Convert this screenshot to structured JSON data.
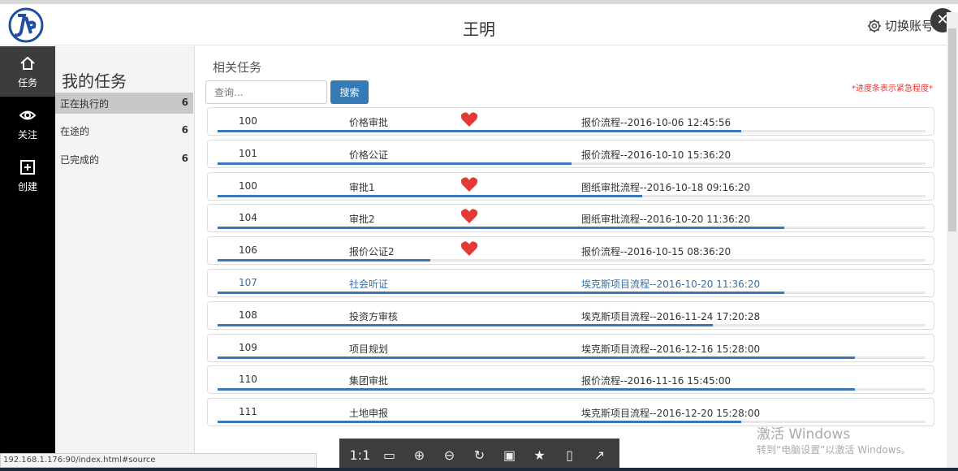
{
  "header": {
    "user_name": "王明",
    "switch_account": "切换账号",
    "close": "✕"
  },
  "leftnav": [
    {
      "label": "任务",
      "icon": "home-icon",
      "active": true
    },
    {
      "label": "关注",
      "icon": "eye-icon",
      "active": false
    },
    {
      "label": "创建",
      "icon": "plus-square-icon",
      "active": false
    }
  ],
  "secondary": {
    "title": "我的任务",
    "items": [
      {
        "label": "正在执行的",
        "count": "6"
      },
      {
        "label": "在途的",
        "count": "6"
      },
      {
        "label": "已完成的",
        "count": "6"
      }
    ]
  },
  "main": {
    "title": "相关任务",
    "search_placeholder": "查询...",
    "search_button": "搜索",
    "note": "*进度条表示紧急程度*"
  },
  "tasks": [
    {
      "id": "100",
      "name": "价格审批",
      "flow": "报价流程--2016-10-06 12:45:56",
      "urgent": true,
      "progress": 0.74
    },
    {
      "id": "101",
      "name": "价格公证",
      "flow": "报价流程--2016-10-10 15:36:20",
      "urgent": false,
      "progress": 0.5
    },
    {
      "id": "100",
      "name": "审批1",
      "flow": "图纸审批流程--2016-10-18 09:16:20",
      "urgent": true,
      "progress": 0.6
    },
    {
      "id": "104",
      "name": "审批2",
      "flow": "图纸审批流程--2016-10-20 11:36:20",
      "urgent": true,
      "progress": 0.8
    },
    {
      "id": "106",
      "name": "报价公证2",
      "flow": "报价流程--2016-10-15 08:36:20",
      "urgent": true,
      "progress": 0.3
    },
    {
      "id": "107",
      "name": "社会听证",
      "flow": "埃克斯项目流程--2016-10-20 11:36:20",
      "urgent": false,
      "progress": 0.8
    },
    {
      "id": "108",
      "name": "投资方审核",
      "flow": "埃克斯项目流程--2016-11-24 17:20:28",
      "urgent": false,
      "progress": 0.7
    },
    {
      "id": "109",
      "name": "项目规划",
      "flow": "埃克斯项目流程--2016-12-16 15:28:00",
      "urgent": false,
      "progress": 0.9
    },
    {
      "id": "110",
      "name": "集团审批",
      "flow": "报价流程--2016-11-16 15:45:00",
      "urgent": false,
      "progress": 0.9
    },
    {
      "id": "111",
      "name": "土地申报",
      "flow": "埃克斯项目流程--2016-12-20 15:28:00",
      "urgent": false,
      "progress": 0.74
    }
  ],
  "status_url": "192.168.1.176:90/index.html#source",
  "viewer_toolbar": [
    "1:1",
    "▭",
    "⊕",
    "⊖",
    "↻",
    "▣",
    "★",
    "▯",
    "↗"
  ],
  "watermark": {
    "line1": "激活 Windows",
    "line2": "转到“电脑设置”以激活 Windows。"
  },
  "colors": {
    "accent": "#337ab7",
    "progress": "#3a77b8",
    "heart": "#e53935",
    "sidebar": "#000000"
  }
}
